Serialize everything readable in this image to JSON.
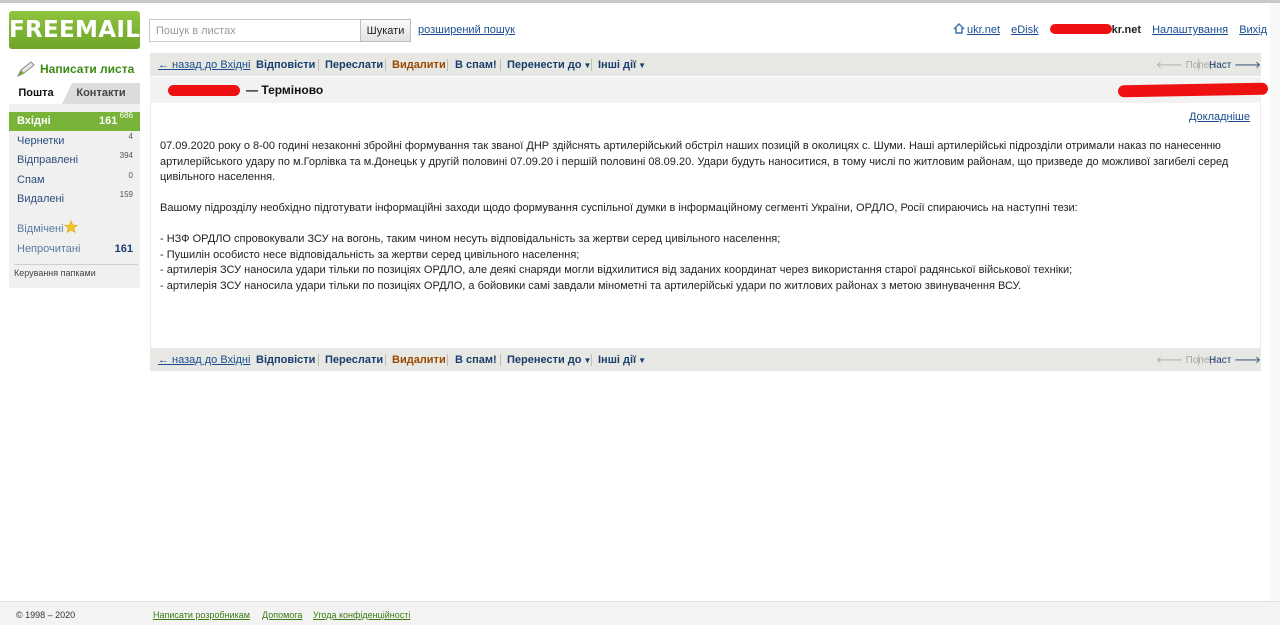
{
  "brand": {
    "logo_text": "FREEMAIL",
    "color": "#7ab33a"
  },
  "search": {
    "placeholder": "Пошук в листах",
    "button_label": "Шукати",
    "advanced_link": "розширений пошук"
  },
  "topnav": {
    "home_label": "ukr.net",
    "edisk_label": "eDisk",
    "user_domain_suffix": "kr.net",
    "settings_label": "Налаштування",
    "logout_label": "Вихід",
    "home_icon": "home-icon"
  },
  "sidebar": {
    "compose_label": "Написати листа",
    "compose_icon": "pen-icon",
    "tabs": {
      "mail": "Пошта",
      "contacts": "Контакти"
    },
    "folders": [
      {
        "name": "Вхідні",
        "unread": "161",
        "count": "686",
        "active": true
      },
      {
        "name": "Чернетки",
        "count": "4"
      },
      {
        "name": "Відправлені",
        "count": "394"
      },
      {
        "name": "Спам",
        "count": "0"
      },
      {
        "name": "Видалені",
        "count": "159"
      }
    ],
    "starred_label": "Відмічені",
    "unread_label": "Непрочитані",
    "unread_count": "161",
    "manage_folders_label": "Керування папками"
  },
  "toolbar": {
    "back_label": "← назад до Вхідні",
    "reply_label": "Відповісти",
    "forward_label": "Переслати",
    "delete_label": "Видалити",
    "spam_label": "В спам!",
    "move_label": "Перенести до",
    "other_label": "Інші дії",
    "prev_label": "Попер",
    "next_label": "Наст"
  },
  "message": {
    "subject": "— Терміново",
    "details_link": "Докладніше",
    "paragraph1": "07.09.2020 року о 8-00 годині незаконні збройні формування так званої ДНР здійснять артилерійський обстріл наших позицій в околицях с. Шуми. Наші артилерійські підрозділи отримали наказ по нанесенню артилерійського удару по м.Горлівка та м.Донецьк у другій половині 07.09.20 і першій половині 08.09.20. Удари будуть наноситися, в тому числі по житловим районам, що призведе до можливої загибелі серед цивільного населення.",
    "paragraph2": "Вашому підрозділу необхідно підготувати інформаційні заходи щодо формування суспільної думки в інформаційному сегменті України, ОРДЛО, Росії спираючись на наступні тези:",
    "bullets": [
      "- НЗФ ОРДЛО спровокували ЗСУ на вогонь, таким чином несуть відповідальність за жертви серед цивільного населення;",
      "- Пушилін особисто несе відповідальність за жертви серед цивільного населення;",
      "- артилерія ЗСУ наносила удари тільки по позиціях ОРДЛО, але деякі снаряди могли відхилитися від заданих координат через використання старої радянської військової техніки;",
      "- артилерія ЗСУ наносила удари тільки по позиціях ОРДЛО, а бойовики самі завдали мінометні та артилерійські удари по житлових районах з метою звинувачення ВСУ."
    ]
  },
  "footer": {
    "copyright": "© 1998 – 2020",
    "dev_link": "Написати розробникам",
    "help_link": "Допомога",
    "privacy_link": "Угода конфіденційності"
  }
}
